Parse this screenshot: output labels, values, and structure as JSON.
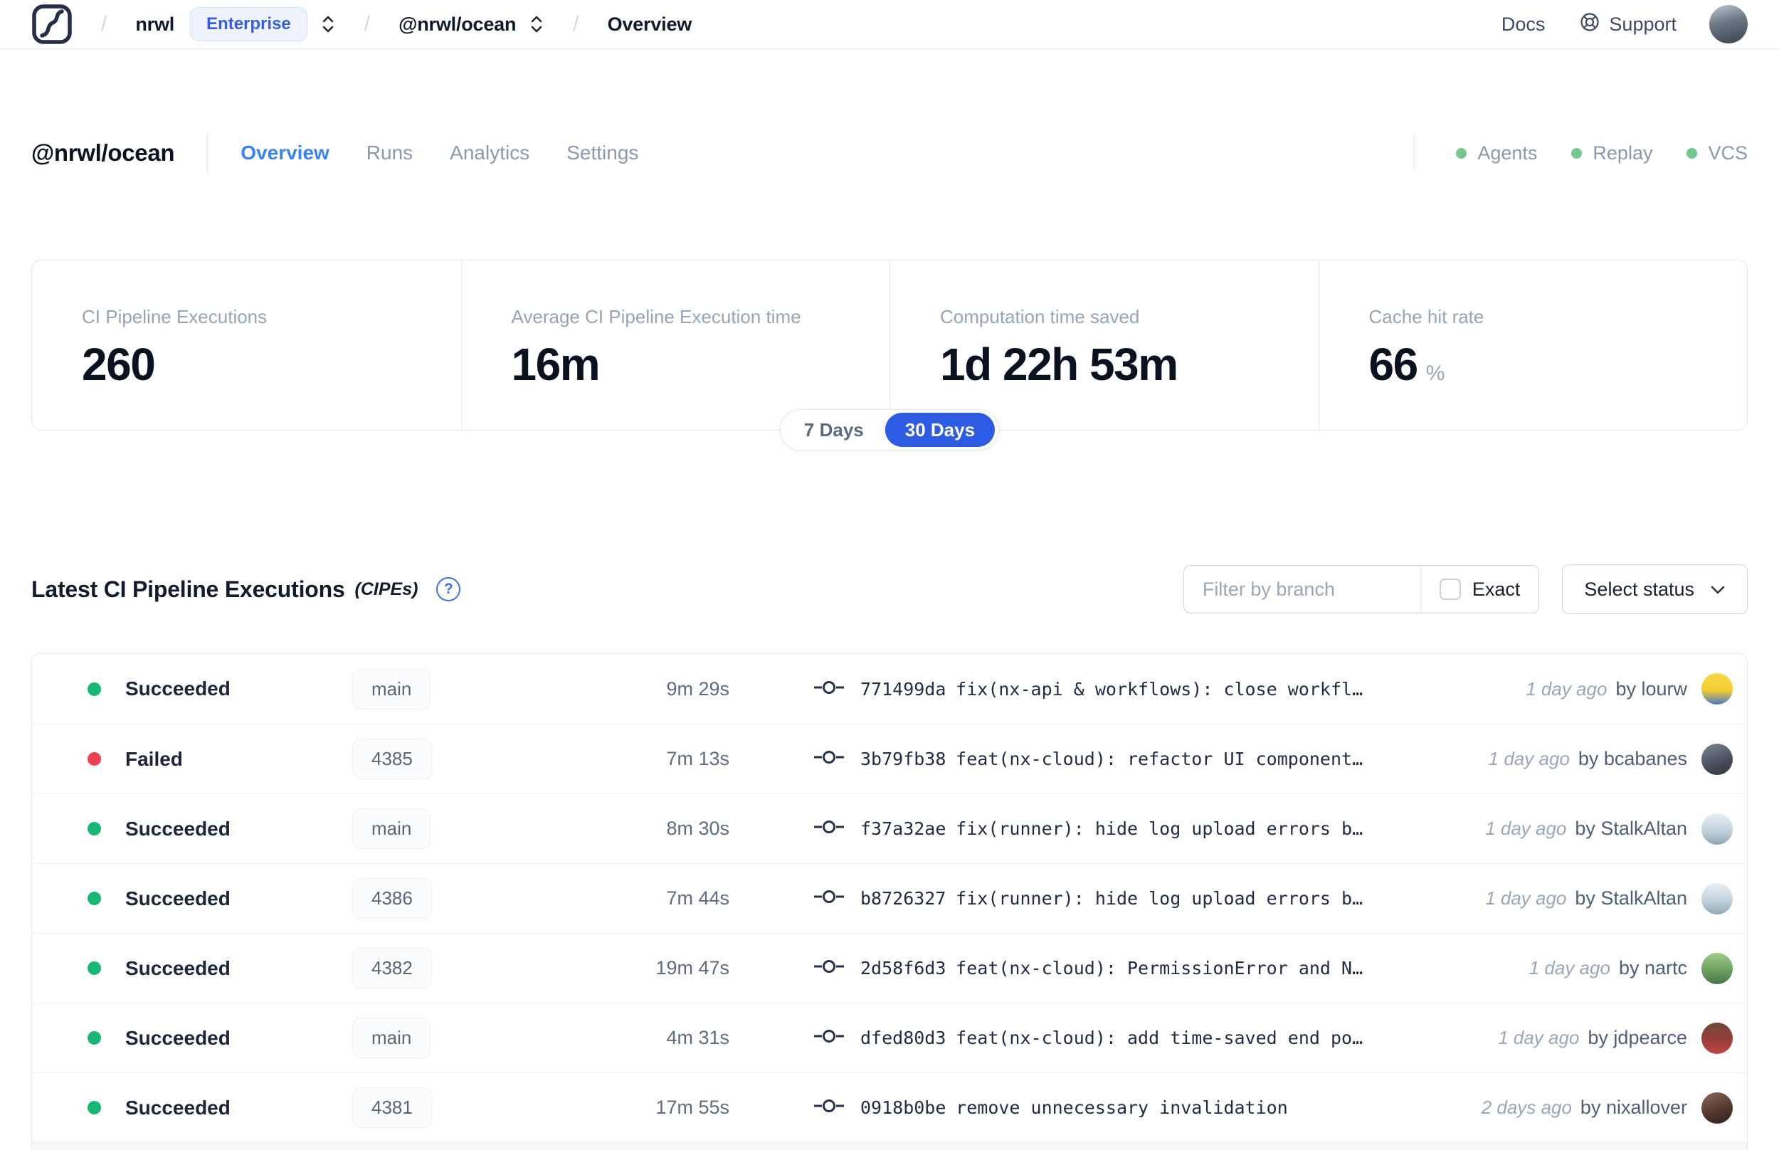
{
  "topbar": {
    "separator": "/",
    "org": "nrwl",
    "org_badge": "Enterprise",
    "workspace": "@nrwl/ocean",
    "page": "Overview",
    "docs": "Docs",
    "support": "Support",
    "user_avatar_bg": "linear-gradient(165deg, #bcc8d1 0%, #6b7684 45%, #3a424e 100%)"
  },
  "header": {
    "title": "@nrwl/ocean",
    "tabs": [
      {
        "label": "Overview",
        "active": true
      },
      {
        "label": "Runs",
        "active": false
      },
      {
        "label": "Analytics",
        "active": false
      },
      {
        "label": "Settings",
        "active": false
      }
    ],
    "indicators": [
      {
        "label": "Agents"
      },
      {
        "label": "Replay"
      },
      {
        "label": "VCS"
      }
    ]
  },
  "stats": {
    "cards": [
      {
        "label": "CI Pipeline Executions",
        "value": "260",
        "suffix": ""
      },
      {
        "label": "Average CI Pipeline Execution time",
        "value": "16m",
        "suffix": ""
      },
      {
        "label": "Computation time saved",
        "value": "1d 22h 53m",
        "suffix": ""
      },
      {
        "label": "Cache hit rate",
        "value": "66",
        "suffix": "%"
      }
    ],
    "range": {
      "options": [
        "7 Days",
        "30 Days"
      ],
      "selected": "30 Days"
    }
  },
  "cipe": {
    "title": "Latest CI Pipeline Executions",
    "title_suffix": "(CIPEs)",
    "help_glyph": "?",
    "filter_placeholder": "Filter by branch",
    "exact_label": "Exact",
    "status_button": "Select status",
    "rows": [
      {
        "status": "Succeeded",
        "status_color": "#18b776",
        "branch": "main",
        "duration": "9m 29s",
        "commit_hash": "771499da",
        "commit_message": "fix(nx-api & workflows): close workfl…",
        "time": "1 day ago",
        "author": "by lourw",
        "avatar_bg": "linear-gradient(180deg, #f8d84a 0%, #f4cd2e 55%, #4a76c9 100%)"
      },
      {
        "status": "Failed",
        "status_color": "#ee4050",
        "branch": "4385",
        "duration": "7m 13s",
        "commit_hash": "3b79fb38",
        "commit_message": "feat(nx-cloud): refactor UI component…",
        "time": "1 day ago",
        "author": "by bcabanes",
        "avatar_bg": "linear-gradient(160deg, #7d8794 0%, #4a5260 55%, #2e343d 100%)"
      },
      {
        "status": "Succeeded",
        "status_color": "#18b776",
        "branch": "main",
        "duration": "8m 30s",
        "commit_hash": "f37a32ae",
        "commit_message": "fix(runner): hide log upload errors b…",
        "time": "1 day ago",
        "author": "by StalkAltan",
        "avatar_bg": "linear-gradient(180deg, #e9eef2 0%, #c3d3de 55%, #8fa6b5 100%)"
      },
      {
        "status": "Succeeded",
        "status_color": "#18b776",
        "branch": "4386",
        "duration": "7m 44s",
        "commit_hash": "b8726327",
        "commit_message": "fix(runner): hide log upload errors b…",
        "time": "1 day ago",
        "author": "by StalkAltan",
        "avatar_bg": "linear-gradient(180deg, #e9eef2 0%, #c3d3de 55%, #8fa6b5 100%)"
      },
      {
        "status": "Succeeded",
        "status_color": "#18b776",
        "branch": "4382",
        "duration": "19m 47s",
        "commit_hash": "2d58f6d3",
        "commit_message": "feat(nx-cloud): PermissionError and N…",
        "time": "1 day ago",
        "author": "by nartc",
        "avatar_bg": "linear-gradient(180deg, #9fc98a 0%, #6da25f 55%, #49724a 100%)"
      },
      {
        "status": "Succeeded",
        "status_color": "#18b776",
        "branch": "main",
        "duration": "4m 31s",
        "commit_hash": "dfed80d3",
        "commit_message": "feat(nx-cloud): add time-saved end po…",
        "time": "1 day ago",
        "author": "by jdpearce",
        "avatar_bg": "linear-gradient(180deg, #6e4438 0%, #9c3f3b 60%, #c24646 100%)"
      },
      {
        "status": "Succeeded",
        "status_color": "#18b776",
        "branch": "4381",
        "duration": "17m 55s",
        "commit_hash": "0918b0be",
        "commit_message": "remove unnecessary invalidation",
        "time": "2 days ago",
        "author": "by nixallover",
        "avatar_bg": "linear-gradient(160deg, #8a6a57 0%, #55382f 55%, #2f2024 100%)"
      }
    ]
  },
  "colors": {
    "accent_blue": "#3b82f6",
    "pill_blue": "#2e5be4",
    "enterprise_blue": "#3a5ce2",
    "success_green": "#18b776",
    "failed_red": "#ee4050",
    "indicator_green": "#74c88e"
  }
}
